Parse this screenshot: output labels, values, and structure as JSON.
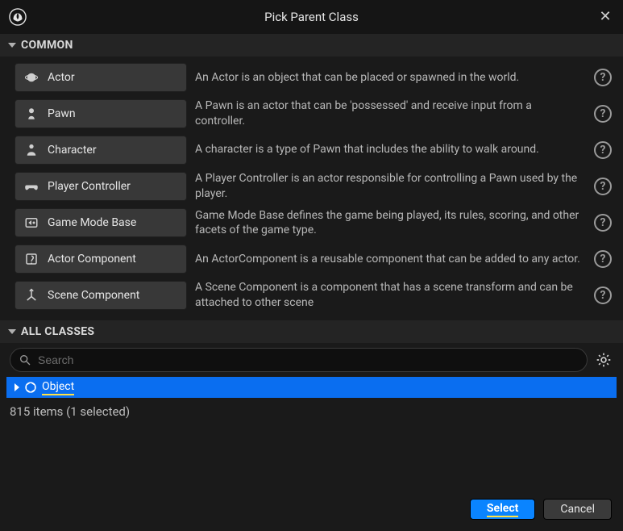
{
  "window": {
    "title": "Pick Parent Class"
  },
  "sections": {
    "common_label": "COMMON",
    "all_classes_label": "ALL CLASSES"
  },
  "common": [
    {
      "label": "Actor",
      "desc": "An Actor is an object that can be placed or spawned in the world.",
      "icon": "actor"
    },
    {
      "label": "Pawn",
      "desc": "A Pawn is an actor that can be 'possessed' and receive input from a controller.",
      "icon": "pawn"
    },
    {
      "label": "Character",
      "desc": "A character is a type of Pawn that includes the ability to walk around.",
      "icon": "character"
    },
    {
      "label": "Player Controller",
      "desc": "A Player Controller is an actor responsible for controlling a Pawn used by the player.",
      "icon": "controller"
    },
    {
      "label": "Game Mode Base",
      "desc": "Game Mode Base defines the game being played, its rules, scoring, and other facets of the game type.",
      "icon": "gamemode"
    },
    {
      "label": "Actor Component",
      "desc": "An ActorComponent is a reusable component that can be added to any actor.",
      "icon": "actorcomp"
    },
    {
      "label": "Scene Component",
      "desc": "A Scene Component is a component that has a scene transform and can be attached to other scene",
      "icon": "scenecomp"
    }
  ],
  "search": {
    "placeholder": "Search"
  },
  "tree": {
    "selected_label": "Object"
  },
  "status": {
    "text": "815 items (1 selected)"
  },
  "footer": {
    "select_label": "Select",
    "cancel_label": "Cancel"
  },
  "chart_data": null
}
